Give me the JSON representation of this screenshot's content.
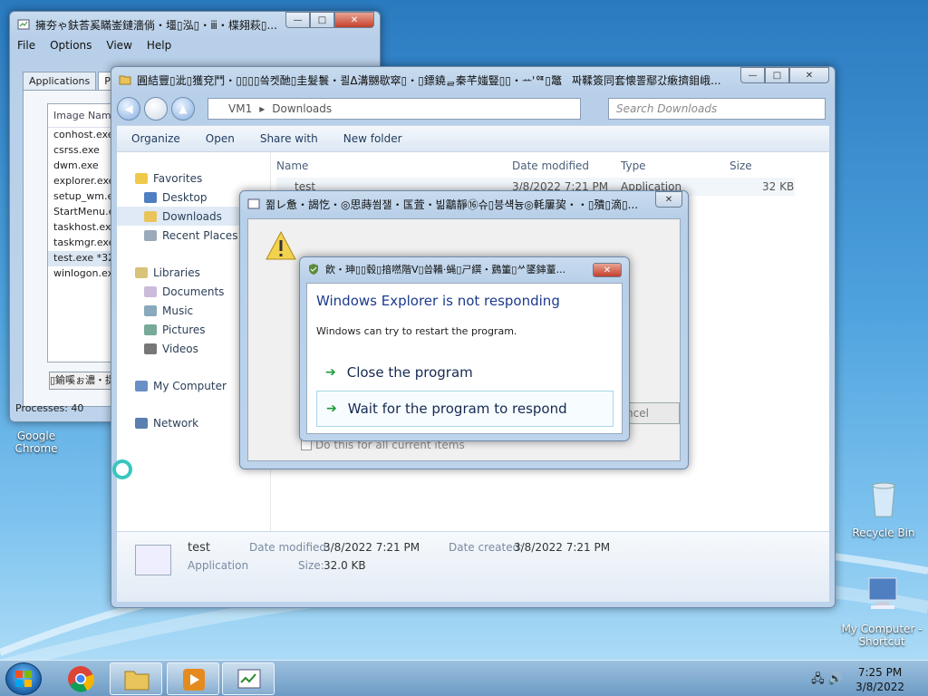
{
  "desktop": {
    "icons": [
      {
        "label": "Google Chrome"
      },
      {
        "label": "Recycle Bin"
      },
      {
        "label": "My Computer - Shortcut"
      }
    ]
  },
  "task_manager": {
    "title": "擁夯ゃ鈇荅奚瞞崟鏈濇倘・壃▯泓▯・ⅲ・楪翗萩▯...",
    "menu": [
      "File",
      "Options",
      "View",
      "Help"
    ],
    "tabs": [
      "Applications",
      "Proce"
    ],
    "column": "Image Name",
    "processes": [
      "conhost.exe",
      "csrss.exe",
      "dwm.exe",
      "explorer.exe",
      "setup_wm.ex...",
      "StartMenu.exe",
      "taskhost.exe",
      "taskmgr.exe",
      "test.exe *32",
      "winlogon.exe"
    ],
    "button": "▯鍮嗘ぉ濃・捉",
    "status": "Processes: 40"
  },
  "explorer": {
    "title": "圓結豐▯泚▯獲兗鬥・▯▯▯▯씈켓酏▯圭髮鬟・쾰ⵠ溝嬲歇窣▯・▯鏢鐃ᆯ秦芊媸豎▯▯・ᅭ'ᅋ▯鼈ᅟ짜鞣簽同套懐뽈鄢갔瘷擠鉬峨...",
    "breadcrumb": [
      "VM1",
      "Downloads"
    ],
    "search_placeholder": "Search Downloads",
    "toolbar": {
      "organize": "Organize",
      "open": "Open",
      "share": "Share with",
      "new_folder": "New folder"
    },
    "nav": {
      "favorites": "Favorites",
      "desktop": "Desktop",
      "downloads": "Downloads",
      "recent": "Recent Places",
      "libraries": "Libraries",
      "documents": "Documents",
      "music": "Music",
      "pictures": "Pictures",
      "videos": "Videos",
      "computer": "My Computer",
      "network": "Network"
    },
    "columns": {
      "name": "Name",
      "date": "Date modified",
      "type": "Type",
      "size": "Size"
    },
    "file": {
      "name": "test",
      "date": "3/8/2022 7:21 PM",
      "type": "Application",
      "size": "32 KB"
    },
    "details": {
      "name": "test",
      "type": "Application",
      "modified_label": "Date modified:",
      "modified": "3/8/2022 7:21 PM",
      "size_label": "Size:",
      "size": "32.0 KB",
      "created_label": "Date created:",
      "created": "3/8/2022 7:21 PM"
    }
  },
  "background_dialog": {
    "title": "쬚レ惫・謁忔・◎思蒔쐼잴・匤萓・빎鸘靜⑯슈▯븡섁늉◎軞屢巭・・▯殨▯滴▯...",
    "cancel": "ncel",
    "checkbox": "Do this for all current items"
  },
  "not_responding": {
    "title": "飮・珅▯▯毂▯揞嘫階V▯씁鞴·蝇▯ㄕ繏・鶢箽▯ᄽ鐆鋛蕫...",
    "heading": "Windows Explorer is not responding",
    "message": "Windows can try to restart the program.",
    "close": "Close the program",
    "wait": "Wait for the program to respond"
  },
  "taskbar": {
    "time": "7:25 PM",
    "date": "3/8/2022"
  }
}
